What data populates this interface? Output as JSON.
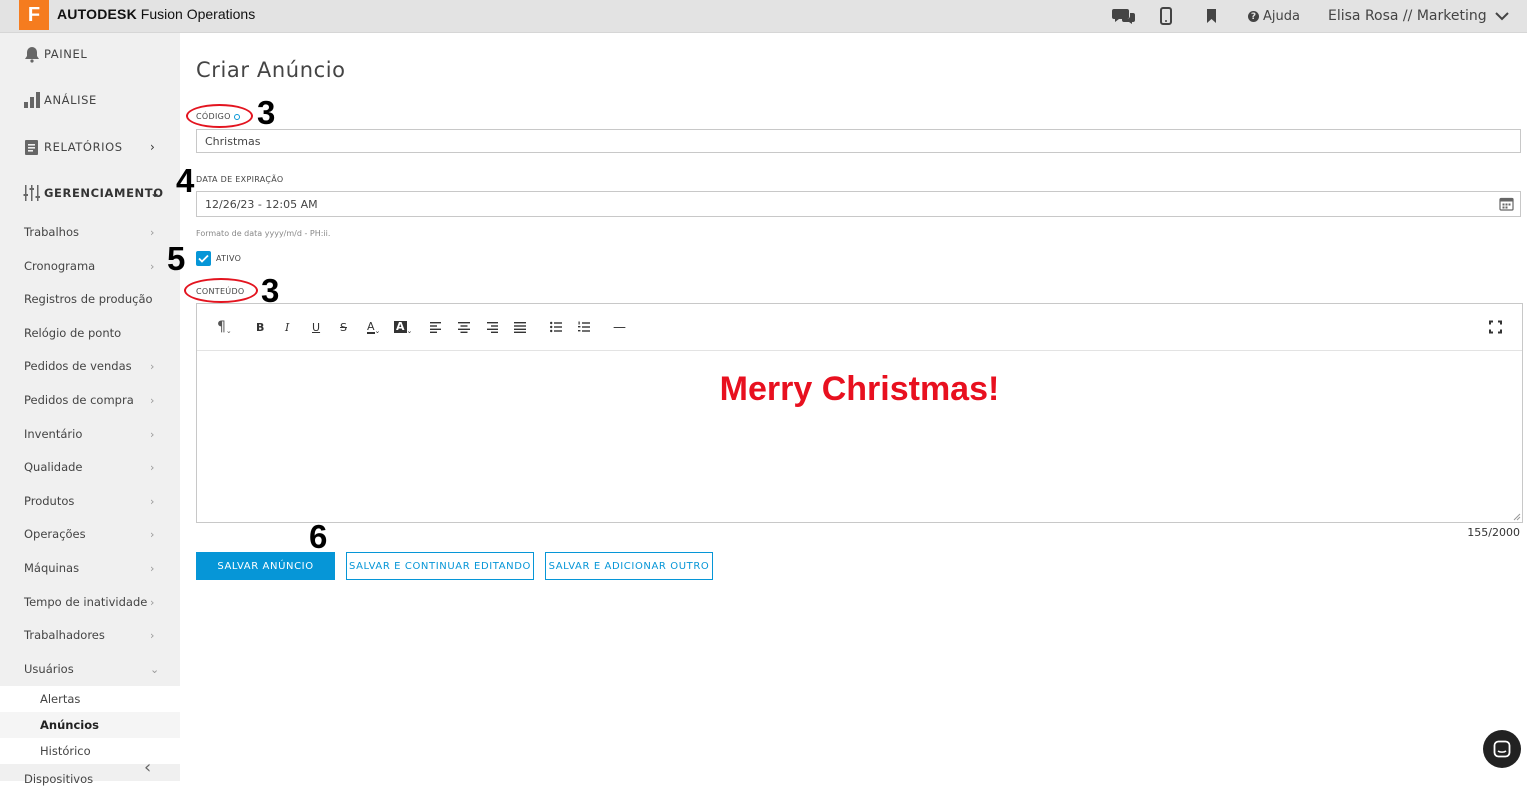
{
  "topbar": {
    "logo_letter": "F",
    "brand_bold": "AUTODESK",
    "brand_rest": "Fusion Operations",
    "help_label": "Ajuda",
    "user_label": "Elisa Rosa // Marketing",
    "icons": [
      "chat-icon",
      "mobile-icon",
      "bookmark-icon",
      "help-icon",
      "chevron-down-icon"
    ]
  },
  "sidebar": {
    "main": [
      {
        "label": "PAINEL",
        "icon": "bell-icon"
      },
      {
        "label": "ANÁLISE",
        "icon": "bar-chart-icon"
      },
      {
        "label": "RELATÓRIOS",
        "icon": "report-icon",
        "chevron": "›"
      },
      {
        "label": "GERENCIAMENTO",
        "icon": "sliders-icon",
        "chevron": "⌄"
      }
    ],
    "sub": [
      {
        "label": "Trabalhos",
        "chevron": "›"
      },
      {
        "label": "Cronograma",
        "chevron": "›"
      },
      {
        "label": "Registros de produção",
        "chevron": ""
      },
      {
        "label": "Relógio de ponto",
        "chevron": ""
      },
      {
        "label": "Pedidos de vendas",
        "chevron": "›"
      },
      {
        "label": "Pedidos de compra",
        "chevron": "›"
      },
      {
        "label": "Inventário",
        "chevron": "›"
      },
      {
        "label": "Qualidade",
        "chevron": "›"
      },
      {
        "label": "Produtos",
        "chevron": "›"
      },
      {
        "label": "Operações",
        "chevron": "›"
      },
      {
        "label": "Máquinas",
        "chevron": "›"
      },
      {
        "label": "Tempo de inatividade",
        "chevron": "›"
      },
      {
        "label": "Trabalhadores",
        "chevron": "›"
      },
      {
        "label": "Usuários",
        "chevron": "⌄"
      }
    ],
    "leaves": [
      "Alertas",
      "Anúncios",
      "Histórico"
    ],
    "cutoff_item": "Dispositivos",
    "collapse_glyph": "‹"
  },
  "form": {
    "title": "Criar Anúncio",
    "code_label": "CÓDIGO",
    "code_value": "Christmas",
    "expiry_label": "DATA DE EXPIRAÇÃO",
    "expiry_value": "12/26/23 - 12:05 AM",
    "format_hint": "Formato de data yyyy/m/d - PH:ii.",
    "active_label": "ATIVO",
    "active_checked": true,
    "content_label": "CONTEÚDO",
    "content_text": "Merry Christmas!",
    "content_color": "#e8101f",
    "counter": "155/2000",
    "toolbar": {
      "paragraph": "¶",
      "bold": "B",
      "italic": "I",
      "underline": "U",
      "strike": "S",
      "font_color": "A",
      "bg_color": "A",
      "hr": "—"
    }
  },
  "buttons": {
    "save": "SALVAR ANÚNCIO",
    "save_continue": "SALVAR E CONTINUAR EDITANDO",
    "save_add": "SALVAR E ADICIONAR OUTRO"
  },
  "annotations": {
    "code_num": "3",
    "expiry_num": "4",
    "active_num": "5",
    "content_num": "3",
    "save_num": "6"
  },
  "colors": {
    "accent": "#0696d7",
    "brand_orange": "#f57c1f",
    "annotation_red": "#e3141f"
  }
}
